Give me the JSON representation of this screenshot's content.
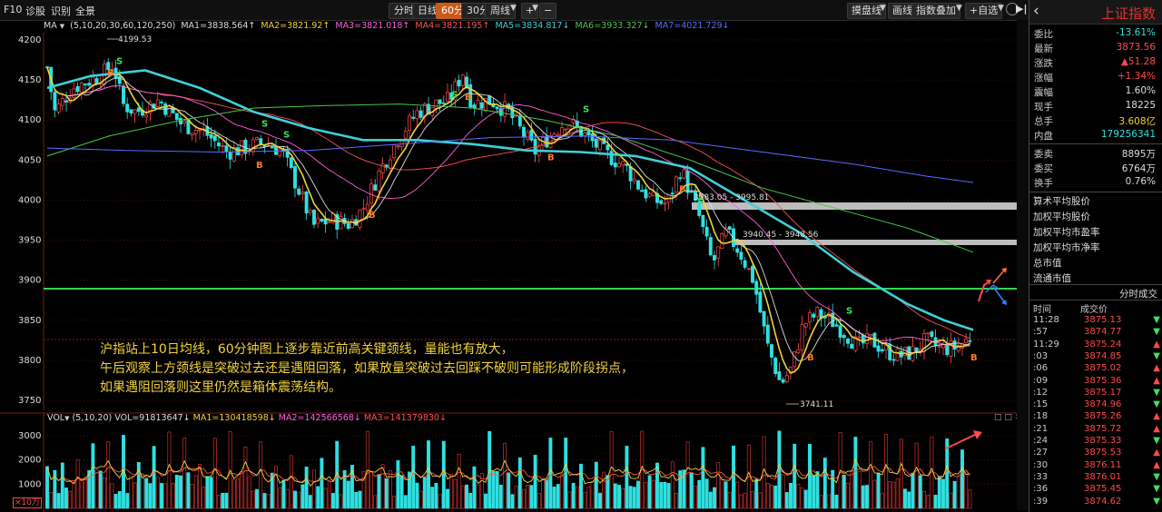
{
  "toolbar": {
    "f10": "F10",
    "diagnose": "诊股",
    "identify": "识别",
    "overview": "全景",
    "tabs": [
      "分时",
      "日线",
      "60分",
      "30分",
      "周线"
    ],
    "active_tab": "60分",
    "zoom_plus": "+",
    "zoom_minus": "−",
    "draw_line": "摸盘线",
    "draw": "画线",
    "index_overlay": "指数叠加",
    "add_watchlist": "+自选"
  },
  "ma_legend": {
    "label": "MA",
    "params": "(5,10,20,30,60,120,250)",
    "ma1": "MA1=3838.564↑",
    "ma2": "MA2=3821.92↑",
    "ma3": "MA3=3821.018↑",
    "ma4": "MA4=3821.195↑",
    "ma5": "MA5=3834.817↓",
    "ma6": "MA6=3933.327↓",
    "ma7": "MA7=4021.729↓"
  },
  "price_axis": [
    "4200",
    "4150",
    "4100",
    "4050",
    "4000",
    "3950",
    "3900",
    "3850",
    "3800",
    "3750"
  ],
  "price_labels": {
    "high": "4199.53",
    "low": "3741.11",
    "gap1": "3983.05 - 3995.81",
    "gap2": "3940.45 - 3948.56",
    "question": "?"
  },
  "annotation": {
    "line1": "沪指站上10日均线，60分钟图上逐步靠近前高关键颈线，量能也有放大，",
    "line2": "午后观察上方颈线是突破过去还是遇阻回落，如果放量突破过去回踩不破则可能形成阶段拐点，",
    "line3": "如果遇阻回落则这里仍然是箱体震荡结构。"
  },
  "vol_legend": {
    "label": "VOL",
    "params": "(5,10,20)",
    "vol": "VOL=91813647↓",
    "ma1": "MA1=130418598↓",
    "ma2": "MA2=142566568↓",
    "ma3": "MA3=141379830↓"
  },
  "vol_axis": [
    "3000",
    "2000",
    "1000"
  ],
  "vol_unit": "×10万",
  "right_panel": {
    "title": "上证指数",
    "rows": [
      {
        "label": "委比",
        "value": "-13.61%",
        "color": "#2ee0e0"
      },
      {
        "label": "最新",
        "value": "3873.56",
        "color": "#ff4a4a"
      },
      {
        "label": "涨跌",
        "value": "▲51.28",
        "color": "#ff4a4a"
      },
      {
        "label": "涨幅",
        "value": "+1.34%",
        "color": "#ff4a4a"
      },
      {
        "label": "震幅",
        "value": "1.60%",
        "color": "#dddddd"
      },
      {
        "label": "现手",
        "value": "18225",
        "color": "#dddddd"
      },
      {
        "label": "总手",
        "value": "3.608亿",
        "color": "#f2d23c"
      },
      {
        "label": "内盘",
        "value": "179256341",
        "color": "#2ee0e0"
      },
      {
        "label": "委卖",
        "value": "8895万",
        "color": "#dddddd"
      },
      {
        "label": "委买",
        "value": "6764万",
        "color": "#dddddd"
      },
      {
        "label": "换手",
        "value": "0.76%",
        "color": "#dddddd"
      }
    ],
    "links": [
      "算术平均股价",
      "加权平均股价",
      "加权平均市盈率",
      "加权平均市净率",
      "总市值",
      "流通市值"
    ],
    "trades_title": "分时成交",
    "trades_col_time": "时间",
    "trades_col_price": "成交价",
    "trades": [
      {
        "time": "11:28",
        "price": "3875.13",
        "arrow": "▼"
      },
      {
        "time": ":57",
        "price": "3874.77",
        "arrow": "▼"
      },
      {
        "time": "11:29",
        "price": "3875.24",
        "arrow": "▲"
      },
      {
        "time": ":03",
        "price": "3874.85",
        "arrow": "▼"
      },
      {
        "time": ":06",
        "price": "3875.02",
        "arrow": "▲"
      },
      {
        "time": ":09",
        "price": "3875.36",
        "arrow": "▲"
      },
      {
        "time": ":12",
        "price": "3875.17",
        "arrow": "▼"
      },
      {
        "time": ":15",
        "price": "3874.96",
        "arrow": "▼"
      },
      {
        "time": ":18",
        "price": "3875.26",
        "arrow": "▲"
      },
      {
        "time": ":21",
        "price": "3875.72",
        "arrow": "▲"
      },
      {
        "time": ":24",
        "price": "3875.33",
        "arrow": "▼"
      },
      {
        "time": ":27",
        "price": "3875.53",
        "arrow": "▲"
      },
      {
        "time": ":30",
        "price": "3876.11",
        "arrow": "▲"
      },
      {
        "time": ":33",
        "price": "3876.01",
        "arrow": "▼"
      },
      {
        "time": ":36",
        "price": "3875.45",
        "arrow": "▼"
      },
      {
        "time": ":39",
        "price": "3874.62",
        "arrow": "▼"
      }
    ]
  },
  "colors": {
    "up": "#ff4a4a",
    "down": "#2ee0e0",
    "ma_yellow": "#f2d23c",
    "ma_thick": "#3fd0d8",
    "neckline": "#38d64a",
    "accent_tab": "#c85a1a"
  }
}
